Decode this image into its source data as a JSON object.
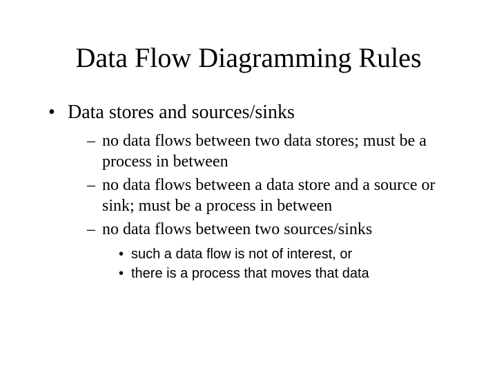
{
  "title": "Data Flow Diagramming Rules",
  "bullets": {
    "l1_0": "Data stores and sources/sinks",
    "l2_0": "no data flows between two data stores; must be a process in between",
    "l2_1": "no data flows between a data store and a source or sink; must be a process in between",
    "l2_2": "no data flows between two sources/sinks",
    "l3_0": "such a data flow is not of interest, or",
    "l3_1": "there is a process that moves that data"
  }
}
